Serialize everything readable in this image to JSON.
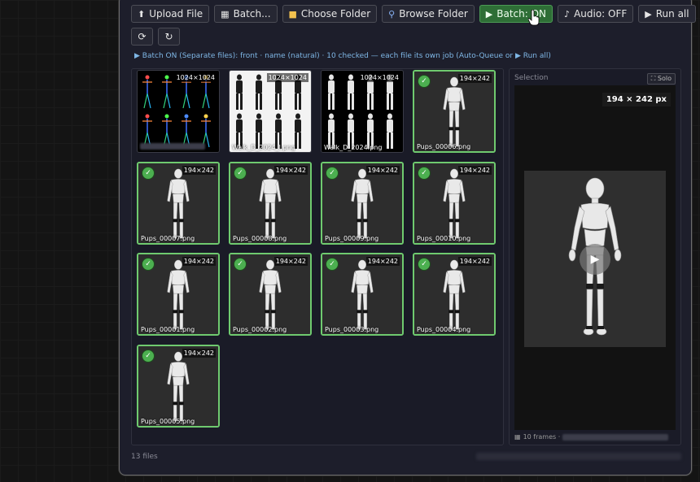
{
  "toolbar": {
    "upload": {
      "icon": "upload-icon",
      "label": "Upload File"
    },
    "batch": {
      "icon": "film-icon",
      "label": "Batch..."
    },
    "choose": {
      "icon": "folder-icon",
      "label": "Choose Folder"
    },
    "browse": {
      "icon": "magnifier-icon",
      "label": "Browse Folder"
    },
    "batch_toggle": {
      "icon": "play-icon",
      "label": "Batch: ON"
    },
    "audio": {
      "icon": "music-icon",
      "label": "Audio: OFF"
    },
    "run_all": {
      "icon": "play-icon",
      "label": "Run all"
    }
  },
  "status": "▶ Batch ON (Separate files): front · name (natural) · 10 checked — each file its own job (Auto-Queue or ▶ Run all)",
  "tiles": [
    {
      "dims": "1024×1024",
      "name": "",
      "checked": false,
      "kind": "skeleton"
    },
    {
      "dims": "1024×1024",
      "name": "Walk_D_2024_l.png",
      "checked": false,
      "kind": "sheet-light"
    },
    {
      "dims": "1024×1024",
      "name": "Walk_D_2024.png",
      "checked": false,
      "kind": "sheet-dark"
    },
    {
      "dims": "194×242",
      "name": "Pups_00006.png",
      "checked": true,
      "kind": "figure"
    },
    {
      "dims": "194×242",
      "name": "Pups_00007.png",
      "checked": true,
      "kind": "figure"
    },
    {
      "dims": "194×242",
      "name": "Pups_00008.png",
      "checked": true,
      "kind": "figure"
    },
    {
      "dims": "194×242",
      "name": "Pups_00009.png",
      "checked": true,
      "kind": "figure"
    },
    {
      "dims": "194×242",
      "name": "Pups_00010.png",
      "checked": true,
      "kind": "figure"
    },
    {
      "dims": "194×242",
      "name": "Pups_00001.png",
      "checked": true,
      "kind": "figure"
    },
    {
      "dims": "194×242",
      "name": "Pups_00002.png",
      "checked": true,
      "kind": "figure"
    },
    {
      "dims": "194×242",
      "name": "Pups_00003.png",
      "checked": true,
      "kind": "figure"
    },
    {
      "dims": "194×242",
      "name": "Pups_00004.png",
      "checked": true,
      "kind": "figure"
    },
    {
      "dims": "194×242",
      "name": "Pups_00005.png",
      "checked": true,
      "kind": "figure"
    }
  ],
  "selection": {
    "label": "Selection",
    "solo": "⛶ Solo",
    "px": "194 × 242 px",
    "frames": "10 frames ·"
  },
  "footer": "13 files",
  "colors": {
    "accent": "#6fca6f",
    "status": "#7fb7e6",
    "on": "#2e6e36"
  }
}
